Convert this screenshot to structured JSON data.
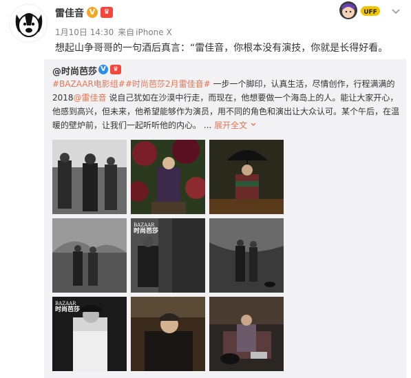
{
  "post": {
    "username": "雷佳音",
    "verified_badge": "V",
    "member_badge": "♛",
    "time": "1月10日 14:30",
    "source_prefix": "来自",
    "source": "iPhone X",
    "text": "想起山争哥哥的一句酒后真言：“雷佳音，你根本没有演技，你就是长得好看。",
    "more_icon": "chevron-down-icon",
    "sticker_label": "UFF"
  },
  "repost": {
    "author": "@时尚芭莎",
    "verified_badge": "V",
    "member_badge": "♛",
    "tag1": "#BAZAAR电影组#",
    "tag2": "#时尚芭莎2月雷佳音#",
    "text_a": " 一步一个脚印，认真生活，尽情创作，行程满满的2018",
    "mention": "@雷佳音",
    "text_b": " 说自己犹如在沙漠中行走，而现在，他想要做一个海岛上的人。能让大家开心，他感到高兴，但未来，他希望能够作为演员，用不同的角色和演出让大众认可。某个午后，在温暖的壁炉前，让我们一起听听他的内心。 ...",
    "expand": "展开全文",
    "expand_icon": "chevron-down-icon",
    "cover_text_1": "BAZAAR",
    "cover_text_2": "时尚芭莎",
    "cover_text_3": "BAZAAR",
    "cover_text_4": "时尚芭莎"
  },
  "colors": {
    "link": "#eb7350",
    "repost_bg": "#f2f2f5",
    "meta": "#808080",
    "verified_orange": "#f5a623",
    "verified_blue": "#2a8fe8"
  }
}
